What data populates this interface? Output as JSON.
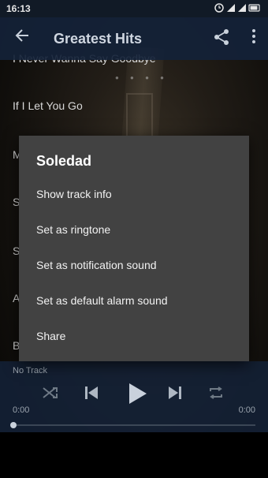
{
  "status_bar": {
    "time": "16:13",
    "icons": "⏰ ▮ ▮ ▮"
  },
  "toolbar": {
    "title": "Greatest Hits"
  },
  "tracks": [
    "I Never Wanna Say Goodbye",
    "If I Let You Go",
    "M",
    "S",
    "S",
    "A",
    "B"
  ],
  "dialog": {
    "title": "Soledad",
    "items": [
      "Show track info",
      "Set as ringtone",
      "Set as notification sound",
      "Set as default alarm sound",
      "Share"
    ]
  },
  "player": {
    "status": "No Track",
    "time_elapsed": "0:00",
    "time_total": "0:00",
    "progress": 0
  },
  "colors": {
    "toolbar": "#142238",
    "dialog": "#424242",
    "accent": "#c9d1dc"
  }
}
